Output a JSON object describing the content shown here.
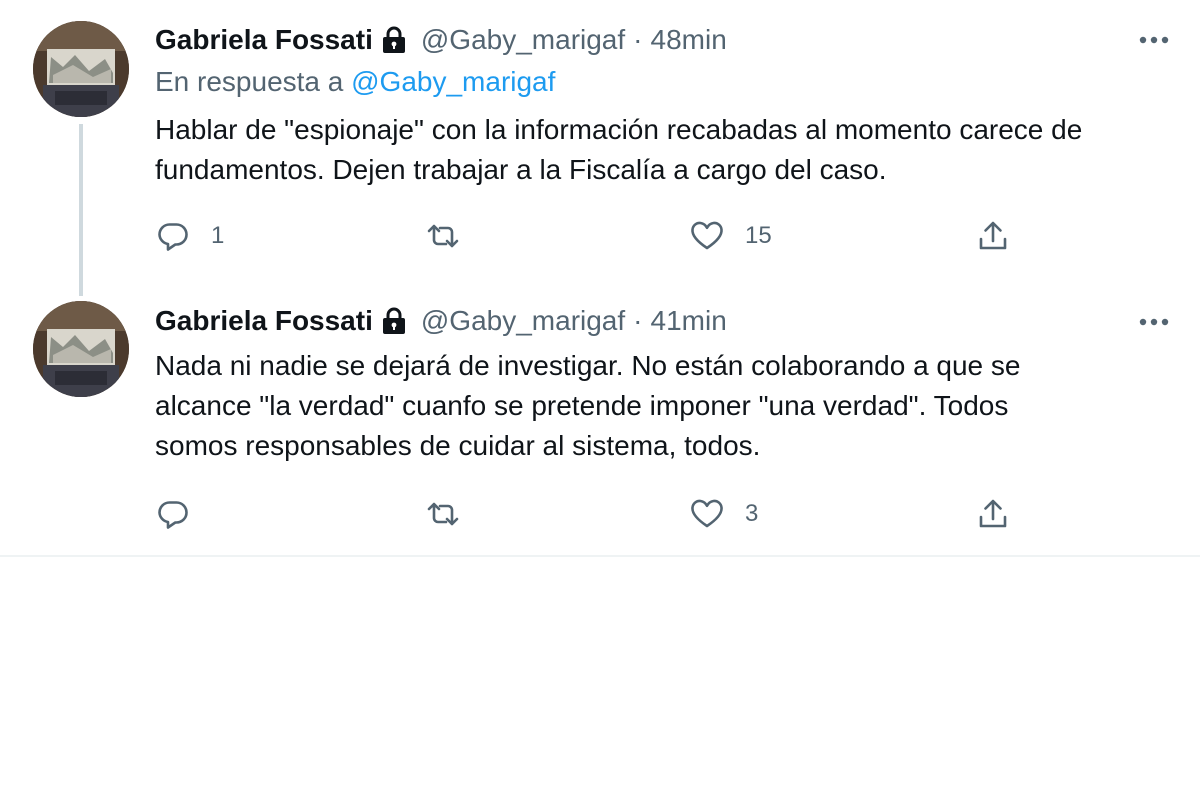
{
  "tweets": [
    {
      "author_name": "Gabriela Fossati",
      "handle": "@Gaby_marigaf",
      "separator": "·",
      "time": "48min",
      "reply_prefix": "En respuesta a",
      "reply_to": "@Gaby_marigaf",
      "text_lines": [
        "Hablar de \"espionaje\" con la información recabadas al momento carece de",
        "fundamentos. Dejen trabajar a la Fiscalía a cargo del caso."
      ],
      "reply_count": "1",
      "retweet_count": "",
      "like_count": "15"
    },
    {
      "author_name": "Gabriela Fossati",
      "handle": "@Gaby_marigaf",
      "separator": "·",
      "time": "41min",
      "text_lines": [
        "Nada ni nadie se dejará de investigar. No están colaborando a que se",
        "alcance \"la verdad\" cuanfo se pretende imponer \"una verdad\". Todos",
        "somos responsables de cuidar al sistema, todos."
      ],
      "reply_count": "",
      "retweet_count": "",
      "like_count": "3"
    }
  ],
  "icons": {
    "lock": "lock-icon",
    "more": "more-icon",
    "reply": "reply-icon",
    "retweet": "retweet-icon",
    "like": "like-icon",
    "share": "share-icon"
  },
  "colors": {
    "text_primary": "#0f1419",
    "text_secondary": "#536471",
    "mention": "#1d9bf0",
    "thread_line": "#cfd9de",
    "divider": "#eff3f4"
  }
}
